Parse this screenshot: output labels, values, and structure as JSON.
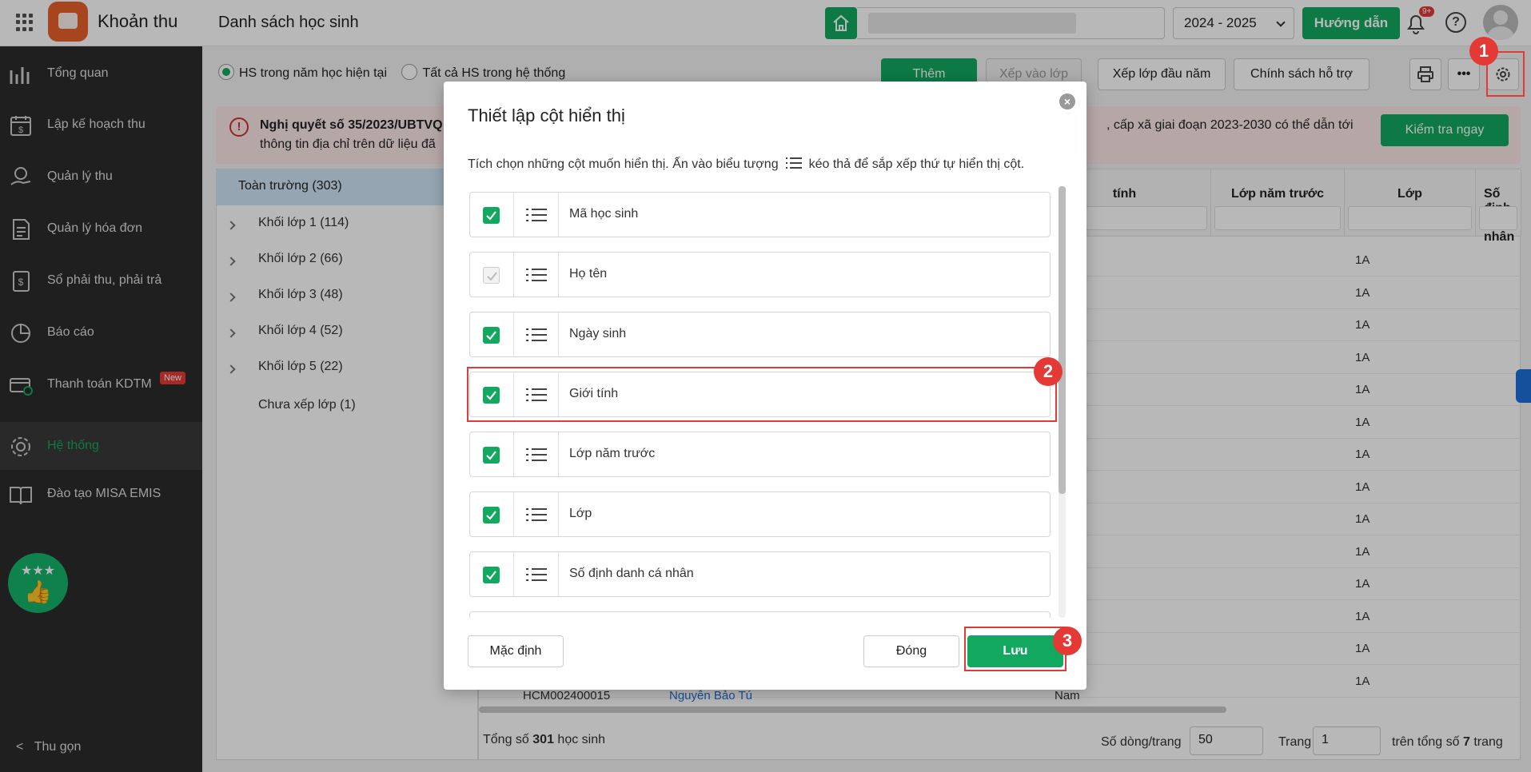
{
  "header": {
    "app_title": "Khoản thu",
    "page_title": "Danh sách học sinh",
    "school_year": "2024 - 2025",
    "guide_label": "Hướng dẫn",
    "notification_badge": "9+"
  },
  "sidebar": {
    "items": [
      {
        "label": "Tổng quan",
        "icon": "bar-chart-icon"
      },
      {
        "label": "Lập kế hoạch thu",
        "icon": "calendar-money-icon"
      },
      {
        "label": "Quản lý thu",
        "icon": "money-hand-icon"
      },
      {
        "label": "Quản lý hóa đơn",
        "icon": "invoice-icon"
      },
      {
        "label": "Sổ phải thu, phải trả",
        "icon": "ledger-icon"
      },
      {
        "label": "Báo cáo",
        "icon": "pie-chart-icon"
      },
      {
        "label": "Thanh toán KDTM",
        "icon": "card-payment-icon",
        "badge": "New"
      },
      {
        "label": "Hệ thống",
        "icon": "gear-icon",
        "active": true
      },
      {
        "label": "Đào tạo MISA EMIS",
        "icon": "book-icon"
      }
    ],
    "collapse_label": "Thu gọn"
  },
  "toolbar": {
    "radio_current": "HS trong năm học hiện tại",
    "radio_all": "Tất cả HS trong hệ thống",
    "add_label": "Thêm",
    "assign_class_label": "Xếp vào lớp",
    "assign_start_label": "Xếp lớp đầu năm",
    "support_policy_label": "Chính sách hỗ trợ",
    "more_label": "•••"
  },
  "notice": {
    "bold_text": "Nghị quyết số 35/2023/UBTVQ",
    "line2": "thông tin địa chỉ trên dữ liệu đã",
    "tail": ", cấp xã giai đoạn 2023-2030 có thể dẫn tới",
    "check_label": "Kiểm tra ngay"
  },
  "tree": {
    "root": "Toàn trường (303)",
    "items": [
      "Khối lớp 1 (114)",
      "Khối lớp 2 (66)",
      "Khối lớp 3 (48)",
      "Khối lớp 4 (52)",
      "Khối lớp 5 (22)",
      "Chưa xếp lớp (1)"
    ]
  },
  "grid": {
    "columns": [
      "tính",
      "Lớp năm trước",
      "Lớp",
      "Số định danh nhân"
    ],
    "class_values": [
      "1A",
      "1A",
      "1A",
      "1A",
      "1A",
      "1A",
      "1A",
      "1A",
      "1A",
      "1A",
      "1A",
      "1A",
      "1A",
      "1A"
    ],
    "last_row": {
      "code": "HCM002400015",
      "name": "Nguyễn Bảo Tú",
      "gender": "Nam"
    },
    "total_prefix": "Tổng số",
    "total_count": "301",
    "total_suffix": "học sinh",
    "rows_per_page_label": "Số dòng/trang",
    "rows_per_page": "50",
    "page_label": "Trang",
    "page": "1",
    "total_pages_text": "trên tổng số",
    "total_pages": "7",
    "pages_suffix": "trang"
  },
  "modal": {
    "title": "Thiết lập cột hiển thị",
    "desc_before": "Tích chọn những cột muốn hiển thị. Ấn vào biểu tượng",
    "desc_after": "kéo thả để sắp xếp thứ tự hiển thị cột.",
    "columns": [
      {
        "label": "Mã học sinh",
        "checked": true
      },
      {
        "label": "Họ tên",
        "checked": true,
        "disabled": true
      },
      {
        "label": "Ngày sinh",
        "checked": true
      },
      {
        "label": "Giới tính",
        "checked": true
      },
      {
        "label": "Lớp năm trước",
        "checked": true
      },
      {
        "label": "Lớp",
        "checked": true
      },
      {
        "label": "Số định danh cá nhân",
        "checked": true
      }
    ],
    "default_label": "Mặc định",
    "close_label": "Đóng",
    "save_label": "Lưu"
  },
  "annotations": {
    "step1": "1",
    "step2": "2",
    "step3": "3"
  },
  "colors": {
    "accent": "#13a85f",
    "sidebar": "#2b2b2b",
    "annotation": "#e53935"
  }
}
